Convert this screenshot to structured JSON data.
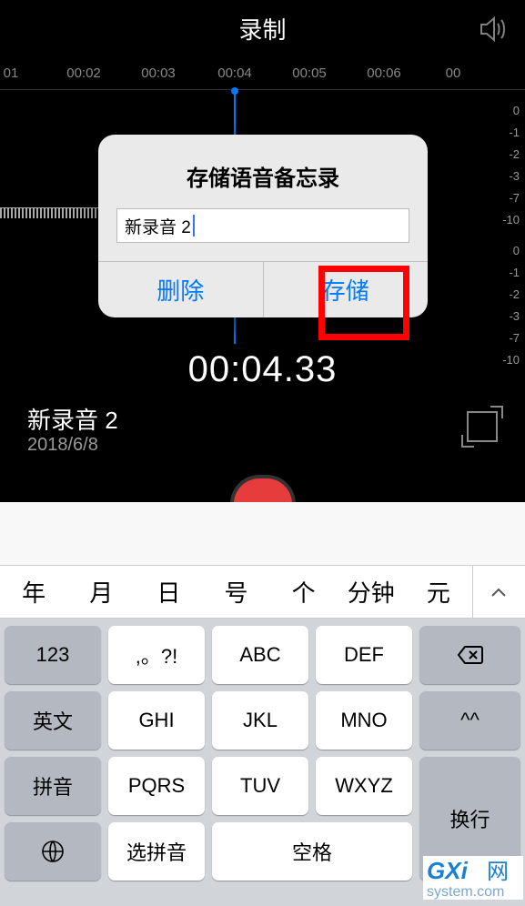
{
  "header": {
    "title": "录制"
  },
  "timeline": [
    "01",
    "00:02",
    "00:03",
    "00:04",
    "00:05",
    "00:06",
    "00"
  ],
  "db": [
    "0",
    "-1",
    "-2",
    "-3",
    "-7",
    "-10"
  ],
  "db2": [
    "0",
    "-1",
    "-2",
    "-3",
    "-7",
    "-10"
  ],
  "recording": {
    "time": "00:04.33",
    "name": "新录音 2",
    "date": "2018/6/8"
  },
  "dialog": {
    "title": "存储语音备忘录",
    "input": "新录音 2",
    "delete": "删除",
    "save": "存储"
  },
  "candidates": [
    "年",
    "月",
    "日",
    "号",
    "个",
    "分钟",
    "元"
  ],
  "keys": {
    "r1": [
      "123",
      ",。?!",
      "ABC",
      "DEF"
    ],
    "r2": [
      "英文",
      "GHI",
      "JKL",
      "MNO",
      "^^"
    ],
    "r3": [
      "拼音",
      "PQRS",
      "TUV",
      "WXYZ"
    ],
    "r4": {
      "pinyin": "选拼音",
      "space": "空格",
      "enter": "换行"
    }
  },
  "watermark": {
    "brand": "GXi",
    "net": "网",
    "url": "system.com"
  }
}
